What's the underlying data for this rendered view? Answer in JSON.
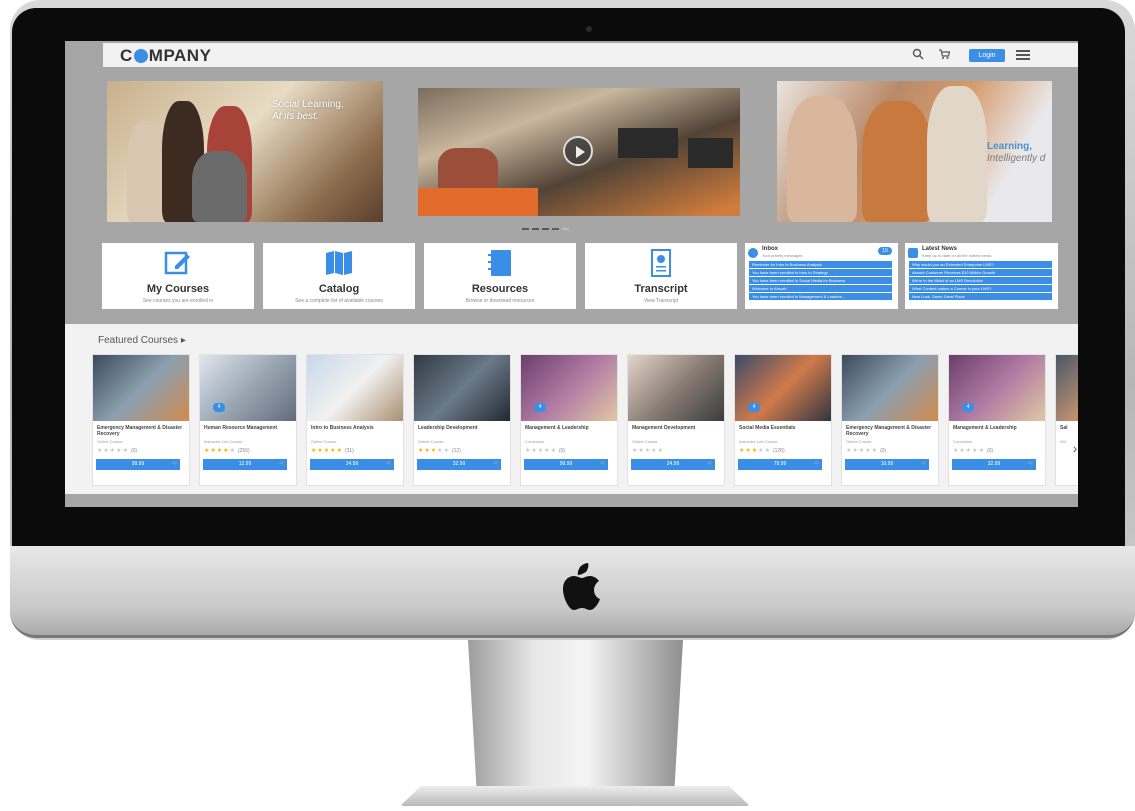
{
  "header": {
    "logo_text_1": "C",
    "logo_text_2": "MPANY",
    "search_icon": "search-icon",
    "cart_icon": "cart-icon",
    "login_label": "Login",
    "menu_icon": "menu-icon"
  },
  "hero": {
    "slide1_line1": "Social Learning,",
    "slide1_line2": "At its best.",
    "slide3_line1": "Learning,",
    "slide3_line2": "Intelligently d"
  },
  "tiles": [
    {
      "title": "My Courses",
      "subtitle": "See courses you are enrolled in",
      "icon": "edit-icon"
    },
    {
      "title": "Catalog",
      "subtitle": "See a complete list of available courses",
      "icon": "book-icon"
    },
    {
      "title": "Resources",
      "subtitle": "Browse or download resources",
      "icon": "notebook-icon"
    },
    {
      "title": "Transcript",
      "subtitle": "View Transcript",
      "icon": "certificate-icon"
    }
  ],
  "inbox": {
    "title": "Inbox",
    "subtitle": "Your priority messages",
    "badge": "10",
    "items": [
      "Reminder for Intro to Business Analysis",
      "You have been enrolled in Intro to Strategy",
      "You have been enrolled in Social Media for Business",
      "Welcome to Absorb",
      "You have been enrolled in Management & Leaders..."
    ]
  },
  "news": {
    "title": "Latest News",
    "subtitle": "Keep up to date on all the hottest news.",
    "items": [
      "Why would you an Extended Enterprise LMS?",
      "Absorb Customer Receives $10 Million Growth",
      "We're in the Midst of an LMS Revolution",
      "What Content makes a Course in your LMS?",
      "New Look, Same Great Place"
    ]
  },
  "featured": {
    "title": "Featured Courses ▸",
    "next_icon": "chevron-right-icon",
    "courses": [
      {
        "title": "Emergency Management & Disaster Recovery",
        "type": "Online Course",
        "rating": 0,
        "count": "(0)",
        "price": "99.99",
        "badge": ""
      },
      {
        "title": "Human Resource Management",
        "type": "Instructor Led Course",
        "rating": 4,
        "count": "(256)",
        "price": "12.99",
        "badge": "4"
      },
      {
        "title": "Intro to Business Analysis",
        "type": "Online Course",
        "rating": 5,
        "count": "(31)",
        "price": "24.99",
        "badge": ""
      },
      {
        "title": "Leadership Development",
        "type": "Online Course",
        "rating": 3,
        "count": "(12)",
        "price": "32.99",
        "badge": ""
      },
      {
        "title": "Management & Leadership",
        "type": "Curriculum",
        "rating": 0,
        "count": "(0)",
        "price": "99.99",
        "badge": "4"
      },
      {
        "title": "Management Development",
        "type": "Online Course",
        "rating": 0,
        "count": "",
        "price": "24.99",
        "badge": ""
      },
      {
        "title": "Social Media Essentials",
        "type": "Instructor Led Course",
        "rating": 3,
        "count": "(128)",
        "price": "79.99",
        "badge": "4"
      },
      {
        "title": "Emergency Management & Disaster Recovery",
        "type": "Online Course",
        "rating": 0,
        "count": "(0)",
        "price": "10.99",
        "badge": ""
      },
      {
        "title": "Management & Leadership",
        "type": "Curriculum",
        "rating": 0,
        "count": "(0)",
        "price": "32.99",
        "badge": "4"
      },
      {
        "title": "Sal",
        "type": "Onl",
        "rating": 0,
        "count": "",
        "price": "",
        "badge": ""
      }
    ]
  },
  "colors": {
    "accent": "#3a8ee6",
    "star": "#f2b400"
  }
}
